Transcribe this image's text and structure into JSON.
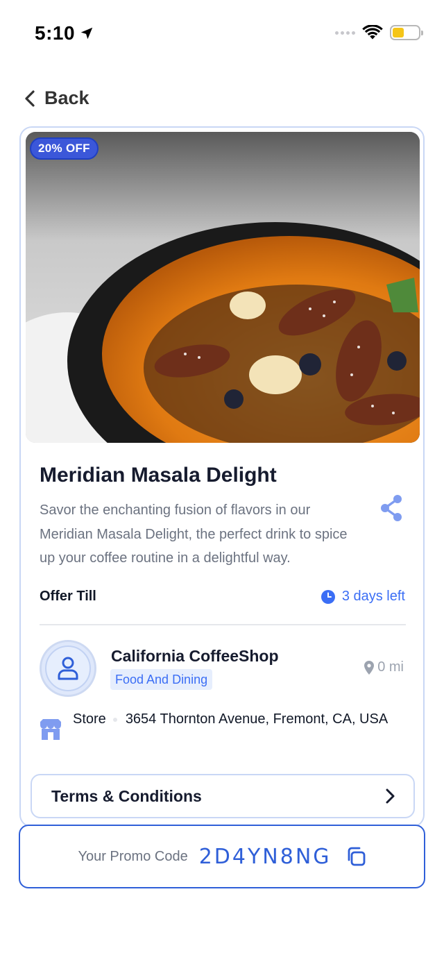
{
  "status_bar": {
    "time": "5:10",
    "icons": [
      "location-arrow-icon",
      "cellular-signal-icon",
      "wifi-icon",
      "battery-icon"
    ],
    "battery_color": "#f5c518"
  },
  "nav": {
    "back_label": "Back",
    "back_icon": "chevron-left-icon"
  },
  "offer": {
    "discount_badge": "20% OFF",
    "title": "Meridian Masala Delight",
    "description": "Savor the enchanting fusion of flavors in our Meridian Masala Delight, the perfect drink to spice up your coffee routine in a delightful way.",
    "offer_till_label": "Offer Till",
    "days_left": "3 days left",
    "accent_color": "#3b6ef5"
  },
  "store": {
    "name": "California CoffeeShop",
    "category": "Food And Dining",
    "distance": "0 mi",
    "type": "Store",
    "address": "3654 Thornton Avenue, Fremont, CA, USA"
  },
  "terms": {
    "label": "Terms & Conditions"
  },
  "promo": {
    "label": "Your Promo Code",
    "code": "2D4YN8NG",
    "border_color": "#2f5fd8"
  }
}
